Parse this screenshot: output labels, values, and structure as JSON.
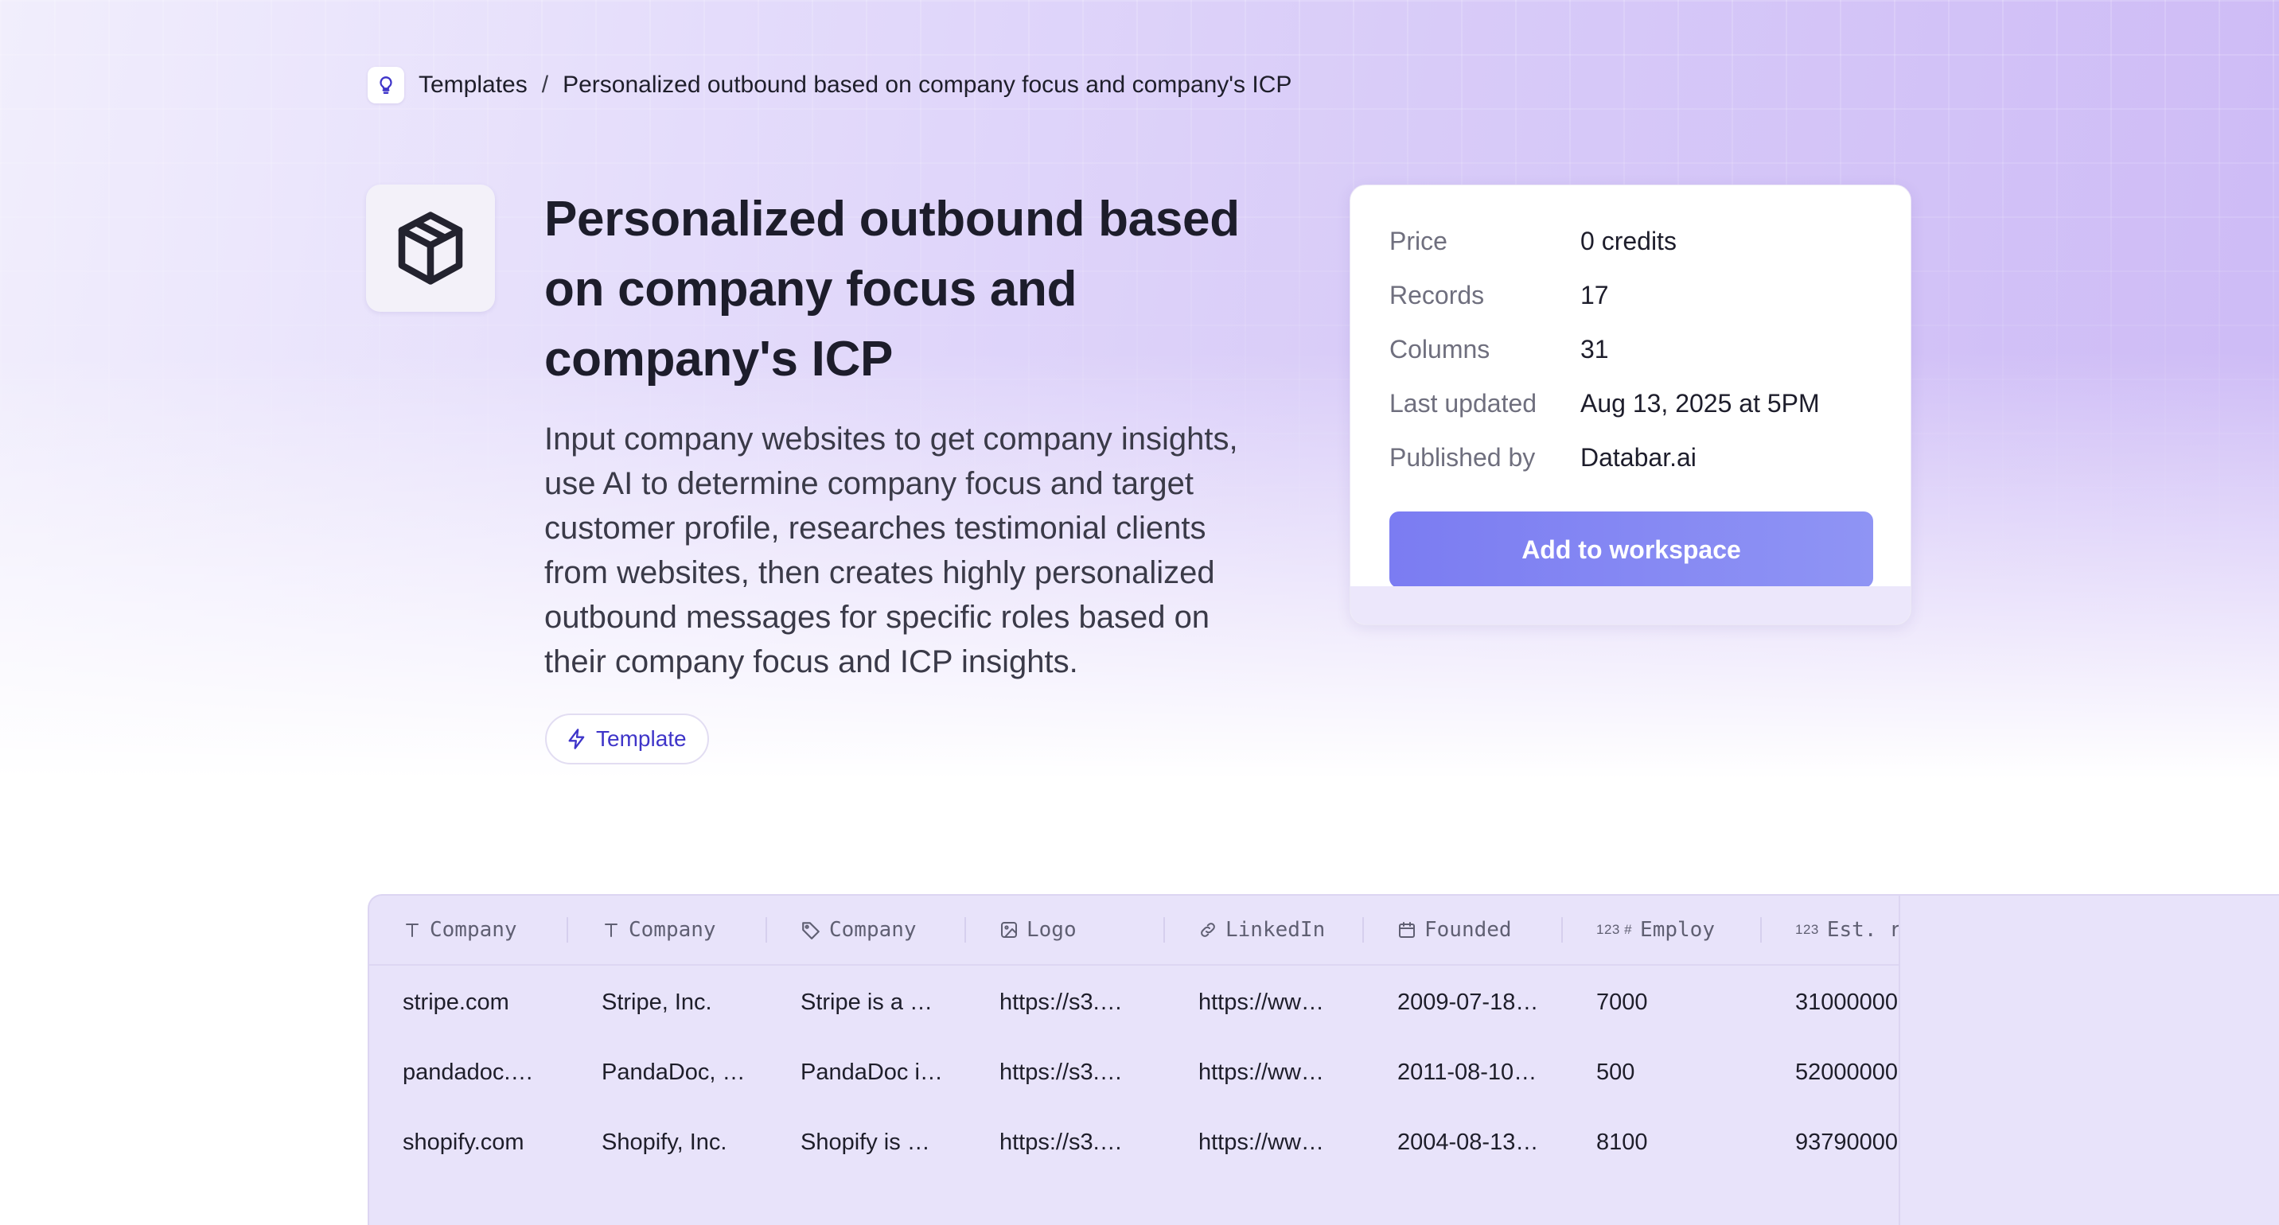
{
  "breadcrumb": {
    "root": "Templates",
    "separator": "/",
    "current": "Personalized outbound based on company focus and company's ICP"
  },
  "hero": {
    "title": "Personalized outbound based on company focus and company's ICP",
    "description": "Input company websites to get company insights, use AI to determine company focus and target customer profile, researches testimonial clients from websites, then creates highly personalized outbound messages for specific roles based on their company focus and ICP insights.",
    "tag": "Template"
  },
  "info": {
    "rows": [
      {
        "label": "Price",
        "value": "0 credits"
      },
      {
        "label": "Records",
        "value": "17"
      },
      {
        "label": "Columns",
        "value": "31"
      },
      {
        "label": "Last updated",
        "value": "Aug 13, 2025 at 5PM"
      },
      {
        "label": "Published by",
        "value": "Databar.ai"
      }
    ],
    "button": "Add to workspace"
  },
  "table": {
    "columns": [
      {
        "label": "Company",
        "icon": "text-type-icon"
      },
      {
        "label": "Company",
        "icon": "text-type-icon"
      },
      {
        "label": "Company",
        "icon": "tag-icon"
      },
      {
        "label": "Logo",
        "icon": "image-icon"
      },
      {
        "label": "LinkedIn",
        "icon": "link-icon"
      },
      {
        "label": "Founded",
        "icon": "calendar-icon"
      },
      {
        "label": "Employ",
        "icon": "number-icon",
        "prefix": "123 #"
      },
      {
        "label": "Est. r",
        "icon": "number-icon",
        "prefix": "123"
      }
    ],
    "rows": [
      [
        "stripe.com",
        "Stripe, Inc.",
        "Stripe is a …",
        "https://s3.…",
        "https://ww…",
        "2009-07-18…",
        "7000",
        "31000000"
      ],
      [
        "pandadoc.…",
        "PandaDoc, …",
        "PandaDoc i…",
        "https://s3.…",
        "https://ww…",
        "2011-08-10…",
        "500",
        "52000000"
      ],
      [
        "shopify.com",
        "Shopify, Inc.",
        "Shopify is …",
        "https://s3.…",
        "https://ww…",
        "2004-08-13…",
        "8100",
        "93790000"
      ]
    ]
  },
  "colors": {
    "accent": "#7b7cf2",
    "tag_text": "#3f35c9",
    "table_bg": "#e8e3fa"
  }
}
